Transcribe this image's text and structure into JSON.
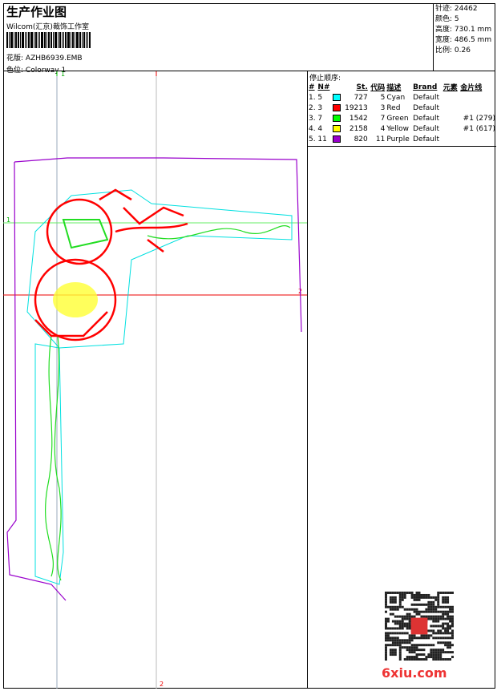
{
  "header": {
    "title": "生产作业图",
    "company": "Wilcom(汇京)裁饰工作室",
    "design_label": "花版:",
    "design_value": "AZHB6939.EMB",
    "colorway_label": "色位:",
    "colorway_value": "Colorway 1"
  },
  "info": [
    {
      "label": "针迹:",
      "value": "24462"
    },
    {
      "label": "颜色:",
      "value": "5"
    },
    {
      "label": "高度:",
      "value": "730.1 mm"
    },
    {
      "label": "宽度:",
      "value": "486.5 mm"
    },
    {
      "label": "比例:",
      "value": "0.26"
    }
  ],
  "stop_sequence": {
    "caption": "停止顺序:",
    "headers": [
      "#",
      "N#",
      "",
      "St.",
      "代码",
      "描述",
      "Brand",
      "元素",
      "金片线"
    ],
    "rows": [
      {
        "idx": "1.",
        "n": "5",
        "color": "#00ffff",
        "st": "727",
        "code": "5",
        "desc": "Cyan",
        "brand": "Default",
        "elem": "",
        "seq": ""
      },
      {
        "idx": "2.",
        "n": "3",
        "color": "#ff0000",
        "st": "19213",
        "code": "3",
        "desc": "Red",
        "brand": "Default",
        "elem": "",
        "seq": ""
      },
      {
        "idx": "3.",
        "n": "7",
        "color": "#00ff00",
        "st": "1542",
        "code": "7",
        "desc": "Green",
        "brand": "Default",
        "elem": "",
        "seq": "#1 (279)"
      },
      {
        "idx": "4.",
        "n": "4",
        "color": "#ffff00",
        "st": "2158",
        "code": "4",
        "desc": "Yellow",
        "brand": "Default",
        "elem": "",
        "seq": "#1 (617)"
      },
      {
        "idx": "5.",
        "n": "11",
        "color": "#9900cc",
        "st": "820",
        "code": "11",
        "desc": "Purple",
        "brand": "Default",
        "elem": "",
        "seq": ""
      }
    ]
  },
  "guides": {
    "v1": "1",
    "h1": "1",
    "h2": "2",
    "v2": "2"
  },
  "watermark": "6xiu.com"
}
